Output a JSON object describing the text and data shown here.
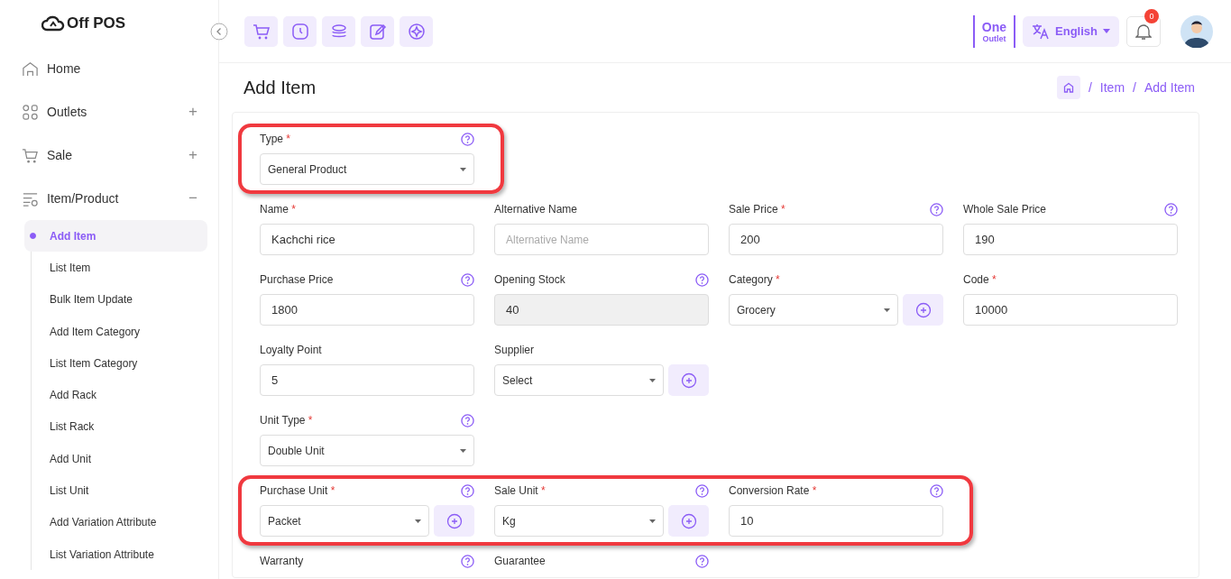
{
  "brand": "Off POS",
  "sidebar": {
    "items": [
      {
        "label": "Home"
      },
      {
        "label": "Outlets",
        "toggle": "+"
      },
      {
        "label": "Sale",
        "toggle": "+"
      },
      {
        "label": "Item/Product",
        "toggle": "−",
        "children": [
          {
            "label": "Add Item",
            "selected": true
          },
          {
            "label": "List Item",
            "selected": false
          },
          {
            "label": "Bulk Item Update",
            "selected": false
          },
          {
            "label": "Add Item Category",
            "selected": false
          },
          {
            "label": "List Item Category",
            "selected": false
          },
          {
            "label": "Add Rack",
            "selected": false
          },
          {
            "label": "List Rack",
            "selected": false
          },
          {
            "label": "Add Unit",
            "selected": false
          },
          {
            "label": "List Unit",
            "selected": false
          },
          {
            "label": "Add Variation Attribute",
            "selected": false
          },
          {
            "label": "List Variation Attribute",
            "selected": false
          }
        ]
      }
    ]
  },
  "header": {
    "outlet_name": "One",
    "outlet_label": "Outlet",
    "language": "English",
    "notification_count": "0"
  },
  "page": {
    "title": "Add Item",
    "breadcrumb_separator": "/",
    "breadcrumb": [
      "Item",
      "Add Item"
    ]
  },
  "form": {
    "rows": [
      {
        "highlighted": true,
        "fields": [
          {
            "label": "Type",
            "required_mark": "*",
            "help": true,
            "kind": "select",
            "value": "General Product",
            "add": false
          }
        ]
      },
      {
        "highlighted": false,
        "fields": [
          {
            "label": "Name",
            "required_mark": "*",
            "help": false,
            "kind": "input",
            "value": "Kachchi rice",
            "add": false
          },
          {
            "label": "Alternative Name",
            "help": false,
            "kind": "input",
            "placeholder": "Alternative Name",
            "add": false
          },
          {
            "label": "Sale Price",
            "required_mark": "*",
            "help": true,
            "kind": "input",
            "value": "200",
            "add": false
          },
          {
            "label": "Whole Sale Price",
            "help": true,
            "kind": "input",
            "value": "190",
            "add": false
          }
        ]
      },
      {
        "highlighted": false,
        "fields": [
          {
            "label": "Purchase Price",
            "help": true,
            "kind": "input",
            "value": "1800",
            "add": false
          },
          {
            "label": "Opening Stock",
            "help": true,
            "kind": "input",
            "value": "40",
            "disabled": true,
            "add": false
          },
          {
            "label": "Category",
            "required_mark": "*",
            "help": false,
            "kind": "select",
            "value": "Grocery",
            "add": true
          },
          {
            "label": "Code",
            "required_mark": "*",
            "help": false,
            "kind": "input",
            "value": "10000",
            "add": false
          }
        ]
      },
      {
        "highlighted": false,
        "fields": [
          {
            "label": "Loyalty Point",
            "help": false,
            "kind": "input",
            "value": "5",
            "add": false
          },
          {
            "label": "Supplier",
            "help": false,
            "kind": "select",
            "value": "Select",
            "add": true
          }
        ]
      },
      {
        "highlighted": false,
        "fields": [
          {
            "label": "Unit Type",
            "required_mark": "*",
            "help": true,
            "kind": "select",
            "value": "Double Unit",
            "add": false
          }
        ]
      },
      {
        "highlighted": true,
        "fields": [
          {
            "label": "Purchase Unit",
            "required_mark": "*",
            "help": true,
            "kind": "select",
            "value": "Packet",
            "add": true
          },
          {
            "label": "Sale Unit",
            "required_mark": "*",
            "help": true,
            "kind": "select",
            "value": "Kg",
            "add": true
          },
          {
            "label": "Conversion Rate",
            "required_mark": "*",
            "help": true,
            "kind": "input",
            "value": "10",
            "add": false
          }
        ]
      },
      {
        "highlighted": false,
        "fields": [
          {
            "label": "Warranty",
            "help": true,
            "kind": "none"
          },
          {
            "label": "Guarantee",
            "help": true,
            "kind": "none"
          }
        ]
      }
    ]
  }
}
